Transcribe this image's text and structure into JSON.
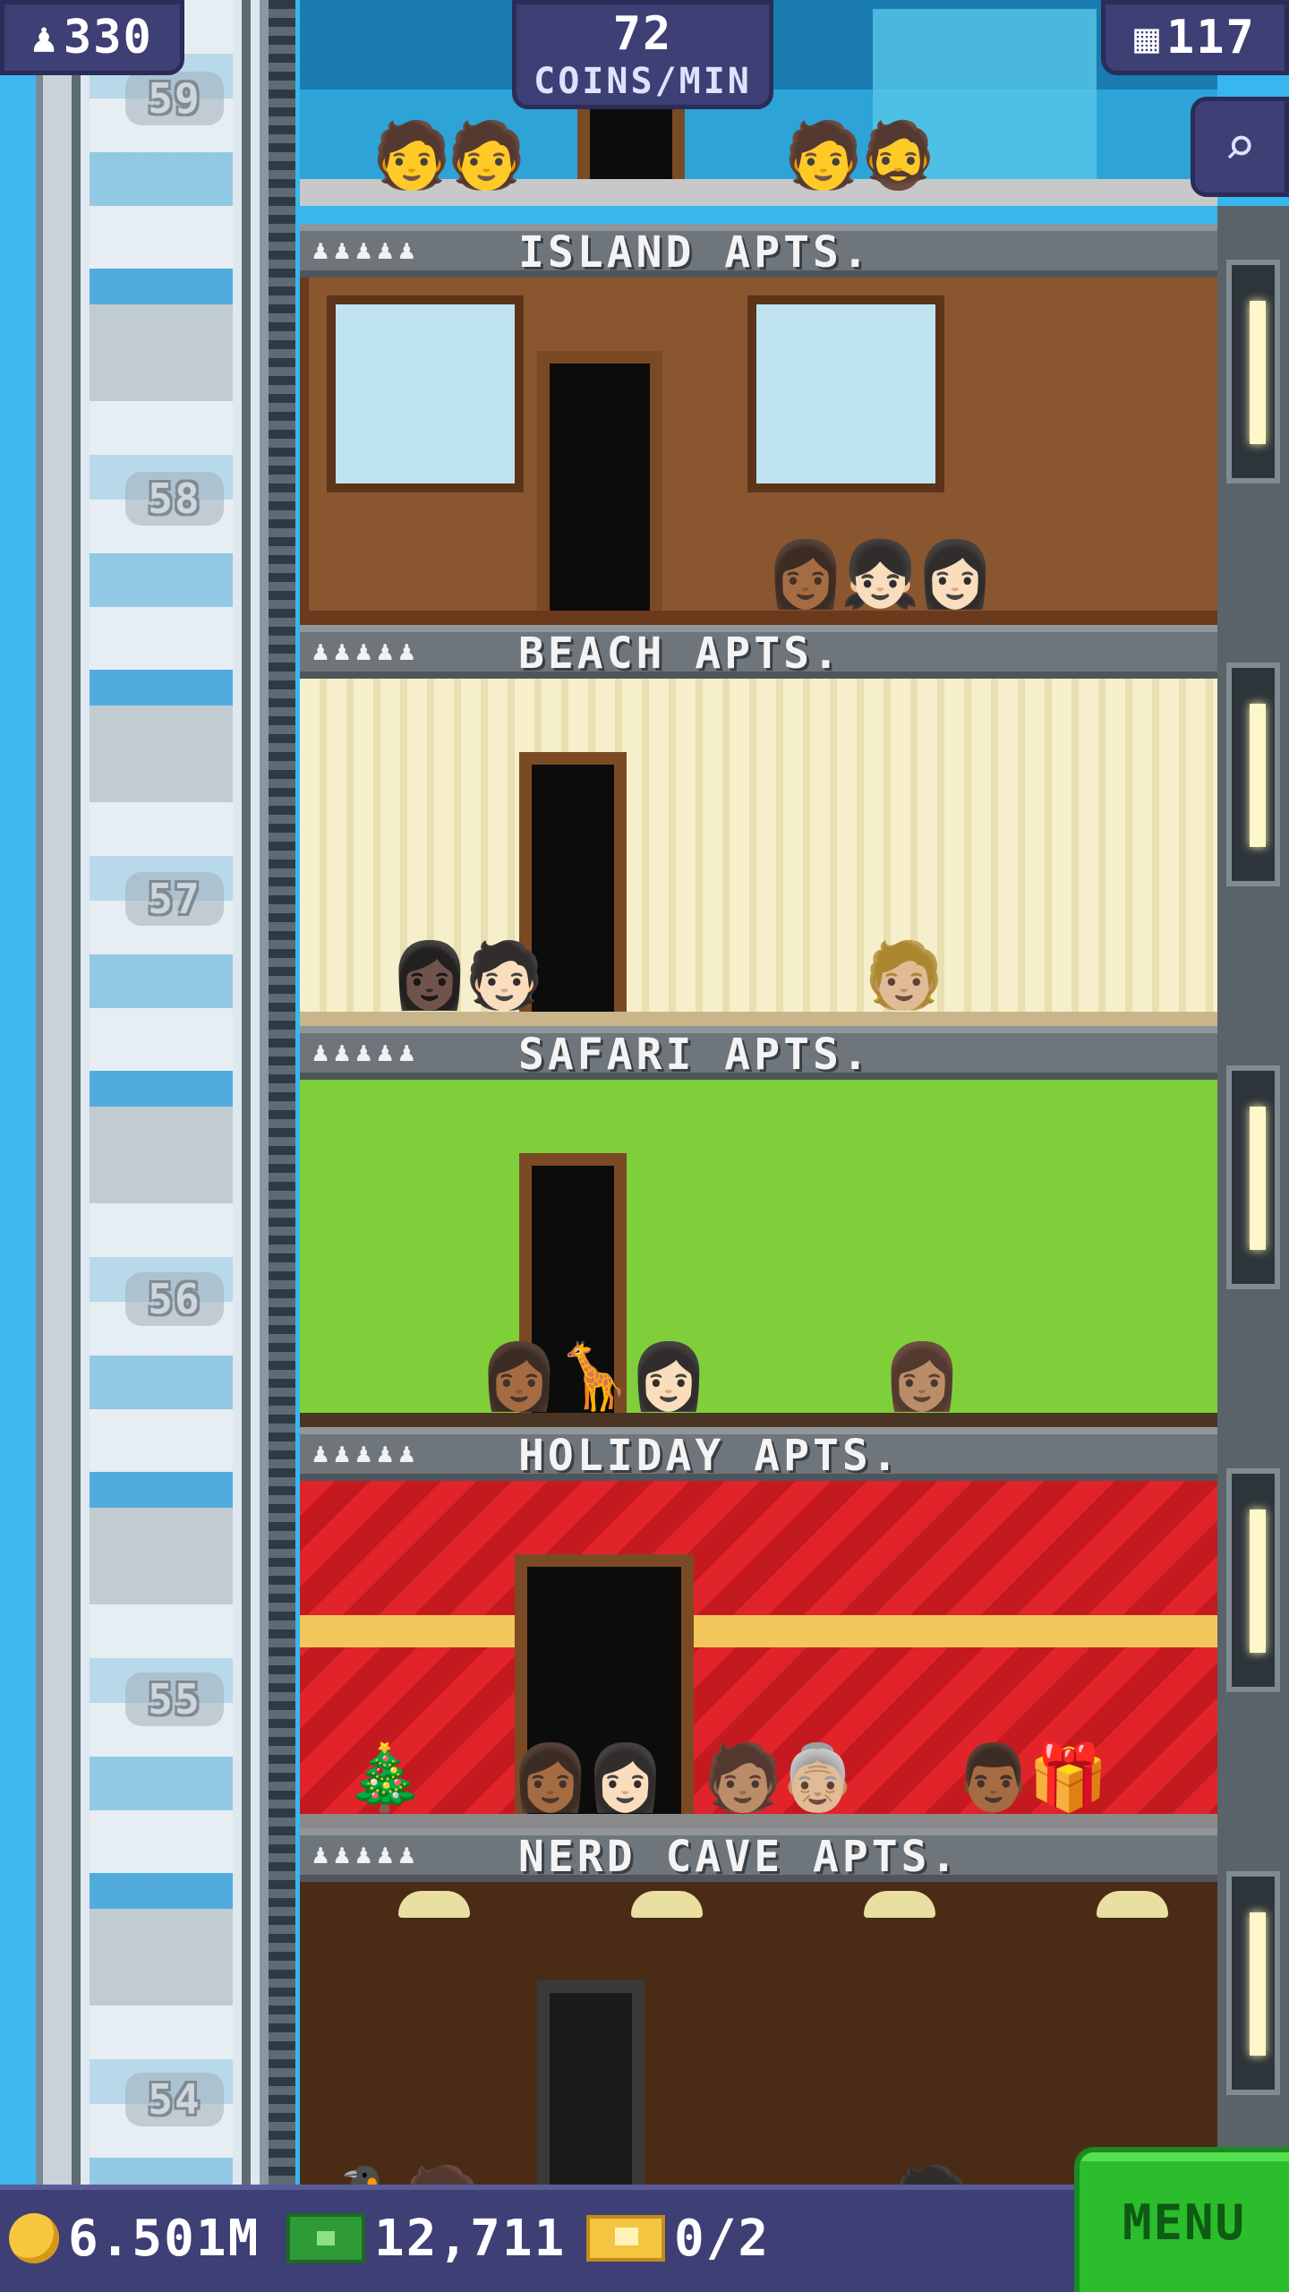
{
  "hud": {
    "population": "330",
    "coins_per_min_value": "72",
    "coins_per_min_label": "COINS/MIN",
    "floor_count": "117"
  },
  "elevator": {
    "floor_numbers": [
      "59",
      "58",
      "57",
      "56",
      "55",
      "54"
    ]
  },
  "floors": [
    {
      "name": "ISLAND APTS.",
      "residents": "♟♟♟♟♟"
    },
    {
      "name": "BEACH APTS.",
      "residents": "♟♟♟♟♟"
    },
    {
      "name": "SAFARI APTS.",
      "residents": "♟♟♟♟♟"
    },
    {
      "name": "HOLIDAY APTS.",
      "residents": "♟♟♟♟♟"
    },
    {
      "name": "NERD CAVE APTS.",
      "residents": "♟♟♟♟♟"
    }
  ],
  "bottom": {
    "coins": "6.501M",
    "tower_bux": "12,711",
    "tickets": "0/2",
    "menu_label": "MENU"
  },
  "icons": {
    "population": "person-icon",
    "floors": "building-icon",
    "search": "magnifier-icon",
    "coins": "coin-icon",
    "bux": "bux-icon",
    "tickets": "ticket-icon"
  }
}
